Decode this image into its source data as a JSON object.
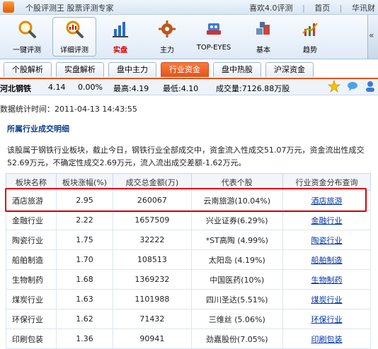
{
  "window": {
    "title": "个股评测王 股票评测专家",
    "right_links": [
      "喜欢4.0评测",
      "首页",
      "华讯财"
    ],
    "separator": "|"
  },
  "toolbar": {
    "buttons": [
      {
        "label": "一键评测",
        "icon": "magnifier-icon"
      },
      {
        "label": "详细评测",
        "icon": "detail-magnifier-icon",
        "active": true
      },
      {
        "label": "实盘",
        "icon": "chart-bars-icon",
        "red": true
      },
      {
        "label": "主力",
        "icon": "gear-icon"
      },
      {
        "label": "TOP-EYES",
        "icon": "eyes-icon"
      },
      {
        "label": "基本",
        "icon": "boxes-icon"
      },
      {
        "label": "趋势",
        "icon": "trend-icon"
      }
    ],
    "scroll": "«"
  },
  "tabs": [
    "个股解析",
    "实盘解析",
    "盘中主力",
    "行业资金",
    "盘中热股",
    "沪深资金"
  ],
  "active_tab": "行业资金",
  "quote": {
    "name": "河北钢铁",
    "price": "4.14",
    "change": "0.00%",
    "high": "最高:4.19",
    "low": "最低:4.10",
    "volume": "成交量:7126.88万股"
  },
  "stat_time": "数据统计时间：2011-04-13 14:43:55",
  "section_title": "所属行业成交明细",
  "description": "该股属于钢铁行业板块，截止今日，钢铁行业全部成交中，资金流入性成交51.07万元，资金流出性成交52.69万元，不确定性成交2.69万元，流入流出成交差额-1.62万元。",
  "table": {
    "headers": [
      "板块名称",
      "板块涨幅(%)",
      "成交总金额(万)",
      "代表个股",
      "行业资金分布查询"
    ],
    "rows": [
      {
        "name": "酒店旅游",
        "change": "2.95",
        "amount": "260067",
        "stock": "云南旅游(10.04%)",
        "link": "酒店旅游"
      },
      {
        "name": "金融行业",
        "change": "2.22",
        "amount": "1657509",
        "stock": "兴业证券(6.29%)",
        "link": "金融行业"
      },
      {
        "name": "陶瓷行业",
        "change": "1.75",
        "amount": "32222",
        "stock": "*ST高陶 (4.99%)",
        "link": "陶瓷行业"
      },
      {
        "name": "船舶制造",
        "change": "1.70",
        "amount": "108513",
        "stock": "太阳岛 (4.19%)",
        "link": "船舶制造"
      },
      {
        "name": "生物制药",
        "change": "1.68",
        "amount": "1369232",
        "stock": "中国医药(10%)",
        "link": "生物制药"
      },
      {
        "name": "煤炭行业",
        "change": "1.63",
        "amount": "1101988",
        "stock": "四川圣达(5.51%)",
        "link": "煤炭行业"
      },
      {
        "name": "环保行业",
        "change": "1.62",
        "amount": "71432",
        "stock": "三维丝 (5.06%)",
        "link": "环保行业"
      },
      {
        "name": "印刷包装",
        "change": "1.36",
        "amount": "90941",
        "stock": "劲嘉股份(7.05%)",
        "link": "印刷包装"
      }
    ]
  }
}
